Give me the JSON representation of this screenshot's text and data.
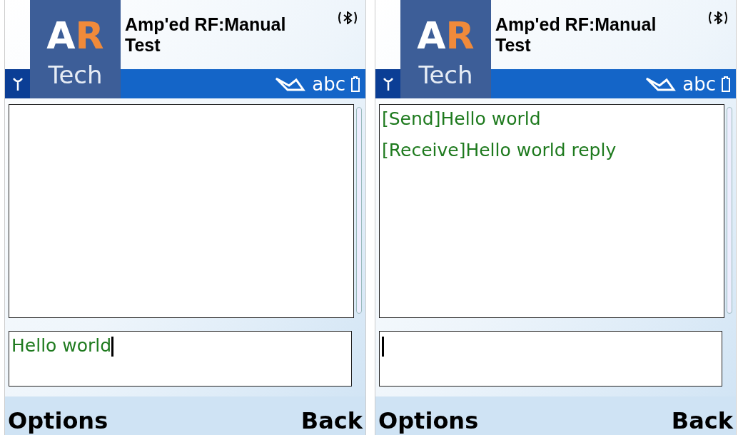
{
  "screens": [
    {
      "title": "Amp'ed RF:Manual Test",
      "logo": {
        "letters": [
          {
            "text": "A",
            "color": "#ffffff"
          },
          {
            "text": "R",
            "color": "#f08a3a"
          }
        ],
        "caption": "Tech"
      },
      "input_mode": "abc",
      "input": {
        "value": "Hello world",
        "focused": true
      },
      "softkeys": {
        "left": "Options",
        "right": "Back"
      }
    },
    {
      "title": "Amp'ed RF:Manual Test",
      "logo": {
        "letters": [
          {
            "text": "A",
            "color": "#ffffff"
          },
          {
            "text": "R",
            "color": "#f08a3a"
          }
        ],
        "caption": "Tech"
      },
      "input_mode": "abc",
      "messages": [
        "[Send]Hello world",
        "[Receive]Hello world reply"
      ],
      "input": {
        "focused": true
      },
      "softkeys": {
        "left": "Options",
        "right": "Back"
      }
    }
  ]
}
